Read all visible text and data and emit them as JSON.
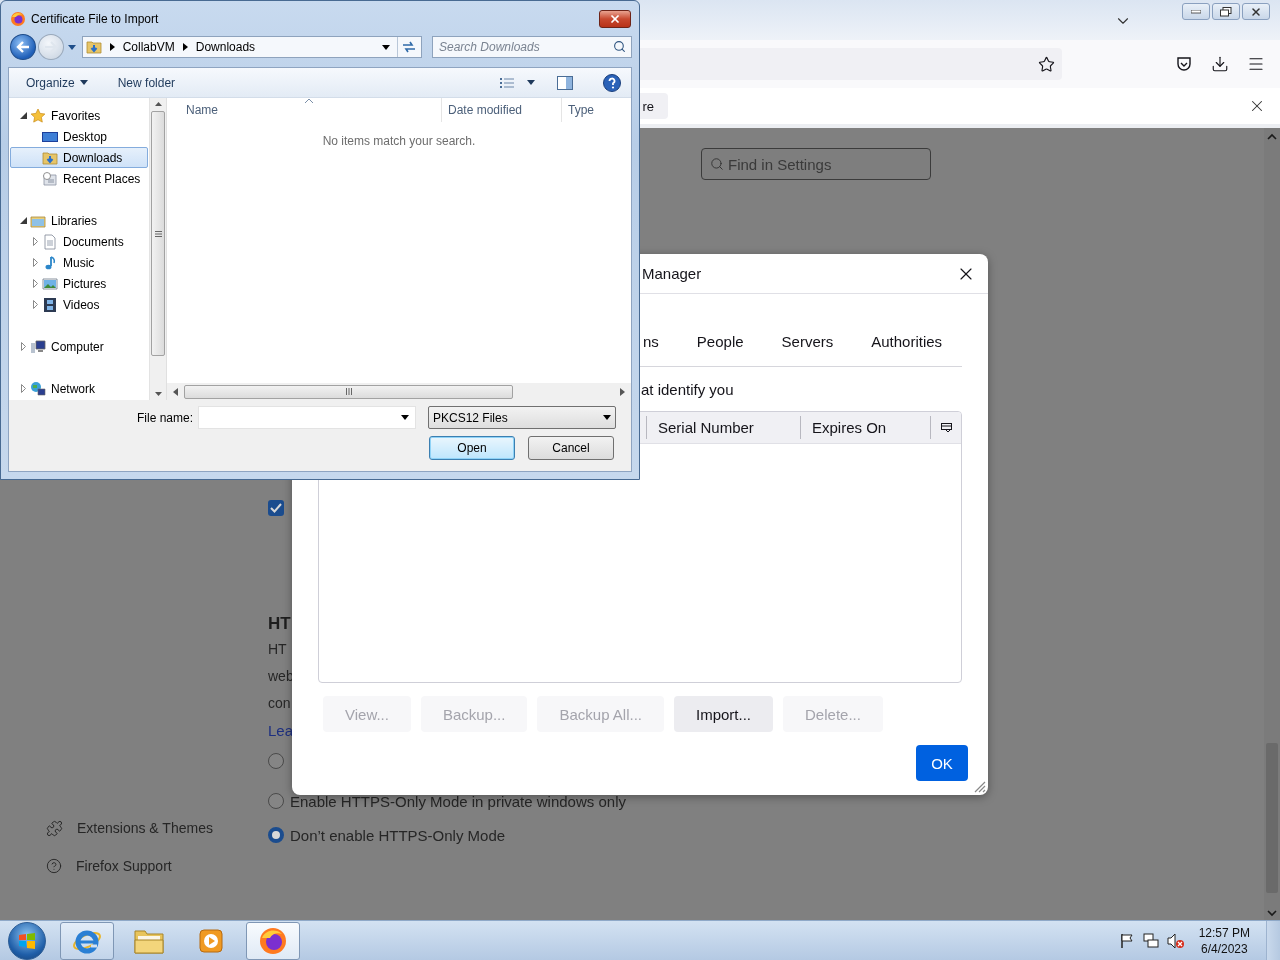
{
  "browser": {
    "notification_button": "re",
    "settings_search": {
      "placeholder": "Find in Settings"
    },
    "sidebar": [
      {
        "label": "Extensions & Themes"
      },
      {
        "label": "Firefox Support"
      }
    ],
    "settings": {
      "checkbox": {
        "checked": true
      },
      "heading": "HT",
      "lines": [
        "HT",
        "web",
        "con"
      ],
      "link": "Lea",
      "radios": [
        {
          "selected": false
        },
        {
          "label": "Enable HTTPS-Only Mode in private windows only",
          "selected": false
        },
        {
          "label": "Don’t enable HTTPS-Only Mode",
          "selected": true
        }
      ]
    }
  },
  "cert_manager": {
    "title": "Manager",
    "tabs": [
      {
        "label": "ns",
        "selected": false
      },
      {
        "label": "People",
        "selected": false
      },
      {
        "label": "Servers",
        "selected": false
      },
      {
        "label": "Authorities",
        "selected": false
      }
    ],
    "description": "at identify you",
    "columns": [
      "Serial Number",
      "Expires On"
    ],
    "buttons": [
      {
        "label": "View...",
        "disabled": true
      },
      {
        "label": "Backup...",
        "disabled": true
      },
      {
        "label": "Backup All...",
        "disabled": true
      },
      {
        "label": "Import...",
        "disabled": false
      },
      {
        "label": "Delete...",
        "disabled": true
      }
    ],
    "ok": "OK"
  },
  "file_dialog": {
    "title": "Certificate File to Import",
    "path": [
      "CollabVM",
      "Downloads"
    ],
    "search": {
      "placeholder": "Search Downloads"
    },
    "toolbar": {
      "organize": "Organize",
      "new_folder": "New folder"
    },
    "tree": [
      {
        "label": "Favorites",
        "expanded": true,
        "selected": false,
        "children": [
          {
            "label": "Desktop",
            "selected": false
          },
          {
            "label": "Downloads",
            "selected": true
          },
          {
            "label": "Recent Places",
            "selected": false
          }
        ]
      },
      {
        "label": "Libraries",
        "expanded": true,
        "selected": false,
        "children": [
          {
            "label": "Documents",
            "expanded": false,
            "selected": false
          },
          {
            "label": "Music",
            "expanded": false,
            "selected": false
          },
          {
            "label": "Pictures",
            "expanded": false,
            "selected": false
          },
          {
            "label": "Videos",
            "expanded": false,
            "selected": false
          }
        ]
      },
      {
        "label": "Computer",
        "expanded": false,
        "selected": false
      },
      {
        "label": "Network",
        "expanded": false,
        "selected": false
      }
    ],
    "columns": [
      "Name",
      "Date modified",
      "Type"
    ],
    "empty_message": "No items match your search.",
    "file_name": {
      "label": "File name:"
    },
    "file_type": "PKCS12 Files",
    "buttons": [
      {
        "label": "Open",
        "default": true
      },
      {
        "label": "Cancel",
        "default": false
      }
    ]
  },
  "taskbar": {
    "apps": [
      {
        "kind": "ie",
        "running": true,
        "selected": false
      },
      {
        "kind": "explorer",
        "running": false,
        "selected": false
      },
      {
        "kind": "media",
        "running": false,
        "selected": false
      },
      {
        "kind": "firefox",
        "running": true,
        "selected": true
      }
    ],
    "clock": {
      "time": "12:57 PM",
      "date": "6/4/2023"
    }
  }
}
